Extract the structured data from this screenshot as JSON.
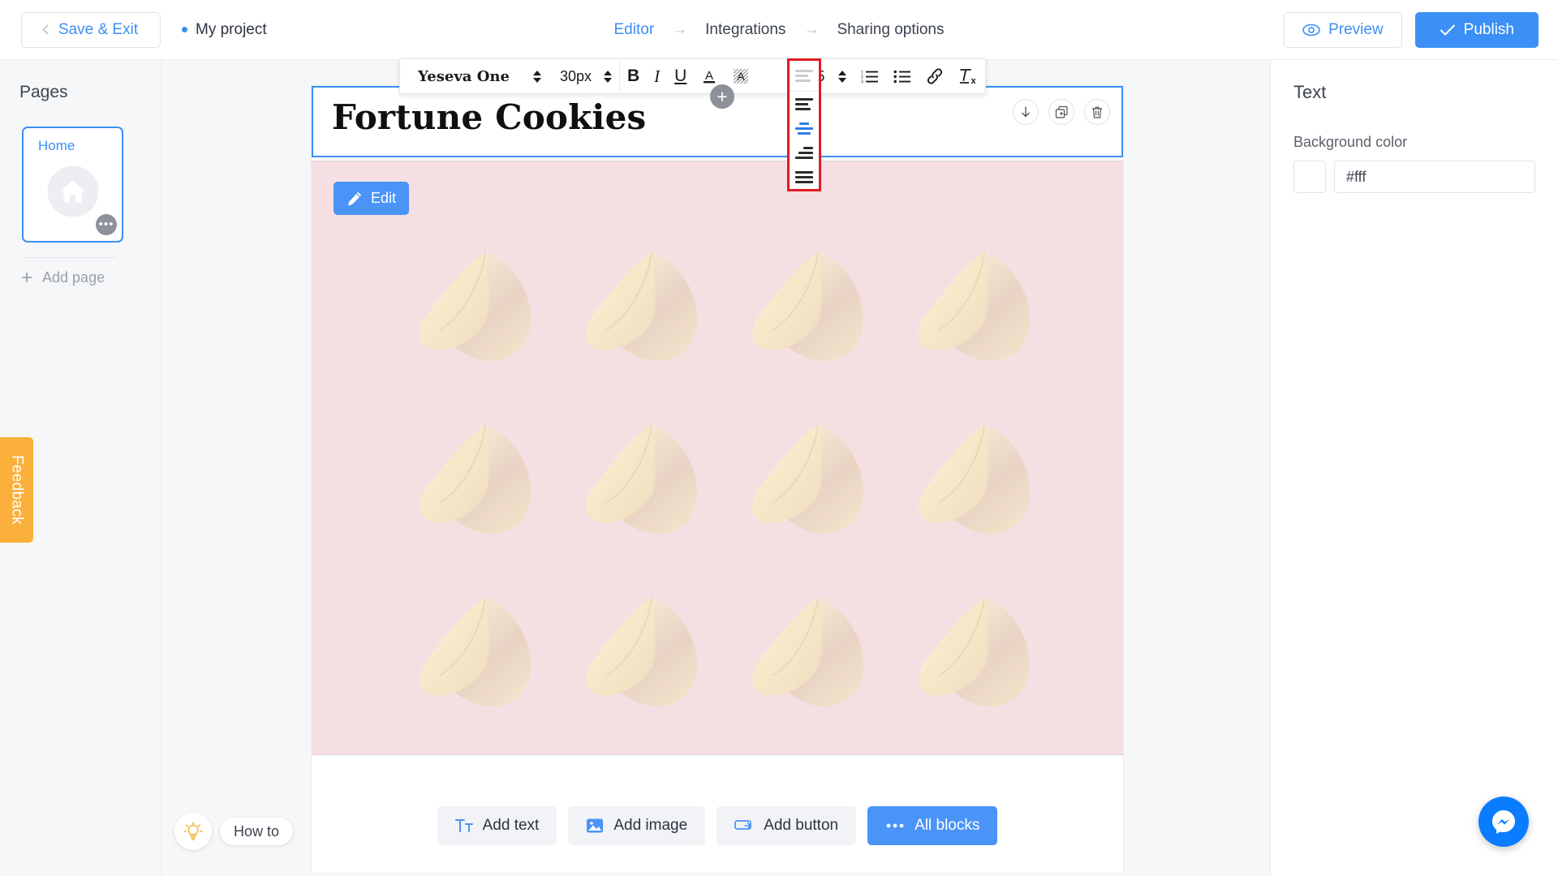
{
  "topbar": {
    "save_exit_label": "Save & Exit",
    "project_name": "My project",
    "breadcrumb": [
      {
        "label": "Editor",
        "active": true
      },
      {
        "label": "Integrations",
        "active": false
      },
      {
        "label": "Sharing options",
        "active": false
      }
    ],
    "breadcrumb_arrow": "→",
    "preview_label": "Preview",
    "publish_label": "Publish"
  },
  "sidebar": {
    "title": "Pages",
    "page_card": {
      "name": "Home",
      "icon": "home-icon",
      "menu": "•••"
    },
    "add_page_label": "Add page",
    "feedback_label": "Feedback"
  },
  "toolbar": {
    "font_family": "Yeseva One",
    "font_size": "30px",
    "bold": "B",
    "italic": "I",
    "underline": "U",
    "font_color": "A",
    "highlight": "A",
    "line_height": "1.5",
    "ordered_list_icon": "ordered-list-icon",
    "unordered_list_icon": "unordered-list-icon",
    "link_icon": "link-icon",
    "clear_format_icon": "clear-formatting-icon"
  },
  "alignment_dropdown": {
    "highlighted": true,
    "highlight_color": "#e01b24",
    "current": "align-left",
    "selected_index": 1,
    "options": [
      {
        "name": "align-left",
        "widths": [
          100,
          72,
          88
        ]
      },
      {
        "name": "align-center",
        "widths": [
          52,
          100,
          76
        ]
      },
      {
        "name": "align-right",
        "widths": [
          56,
          84,
          100
        ]
      },
      {
        "name": "align-justify",
        "widths": [
          100,
          100,
          100
        ]
      }
    ]
  },
  "canvas": {
    "heading": "Fortune Cookies",
    "block_controls": [
      {
        "name": "move-down-button",
        "icon": "arrow-down-icon"
      },
      {
        "name": "duplicate-button",
        "icon": "copy-icon"
      },
      {
        "name": "delete-button",
        "icon": "trash-icon"
      }
    ],
    "edit_label": "Edit",
    "image_block_background": "#f5dfe3",
    "cookie_count": 12,
    "cookie_alt": "fortune-cookie"
  },
  "bottom_actions": [
    {
      "label": "Add text",
      "icon": "text-icon",
      "primary": false
    },
    {
      "label": "Add image",
      "icon": "image-icon",
      "primary": false
    },
    {
      "label": "Add button",
      "icon": "button-icon",
      "primary": false
    },
    {
      "label": "All blocks",
      "icon": "dots-icon",
      "primary": true
    }
  ],
  "howto": {
    "label": "How to",
    "icon": "lightbulb-icon"
  },
  "rightpanel": {
    "title": "Text",
    "background_color_label": "Background color",
    "background_color_value": "#fff",
    "swatch_color": "#ffffff"
  },
  "messenger": {
    "icon": "messenger-icon",
    "color": "#0a7cff"
  }
}
